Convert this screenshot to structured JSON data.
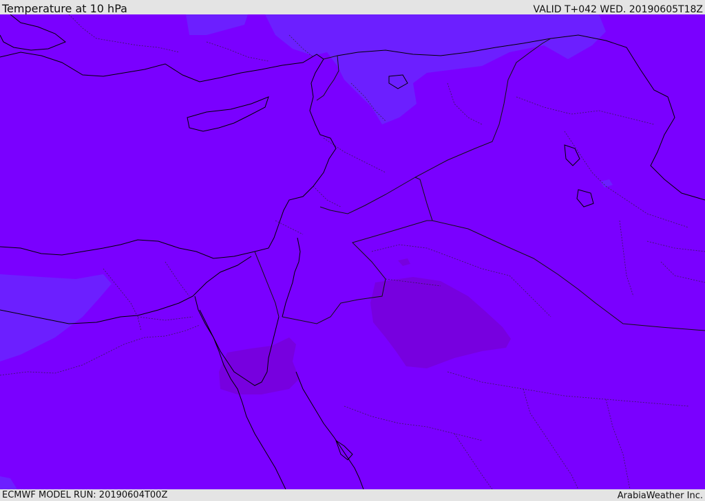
{
  "header": {
    "title": "Temperature at 10 hPa",
    "valid_time": "VALID T+042 WED. 20190605T18Z"
  },
  "footer": {
    "model_run": "ECMWF MODEL RUN: 20190604T00Z",
    "credit": "ArabiaWeather Inc."
  },
  "colors": {
    "base_fill": "#7a00ff",
    "cooler_fill": "#6a1cff",
    "warmer_fill": "#7a00e0",
    "coastline": "#000000",
    "border": "#333333"
  }
}
